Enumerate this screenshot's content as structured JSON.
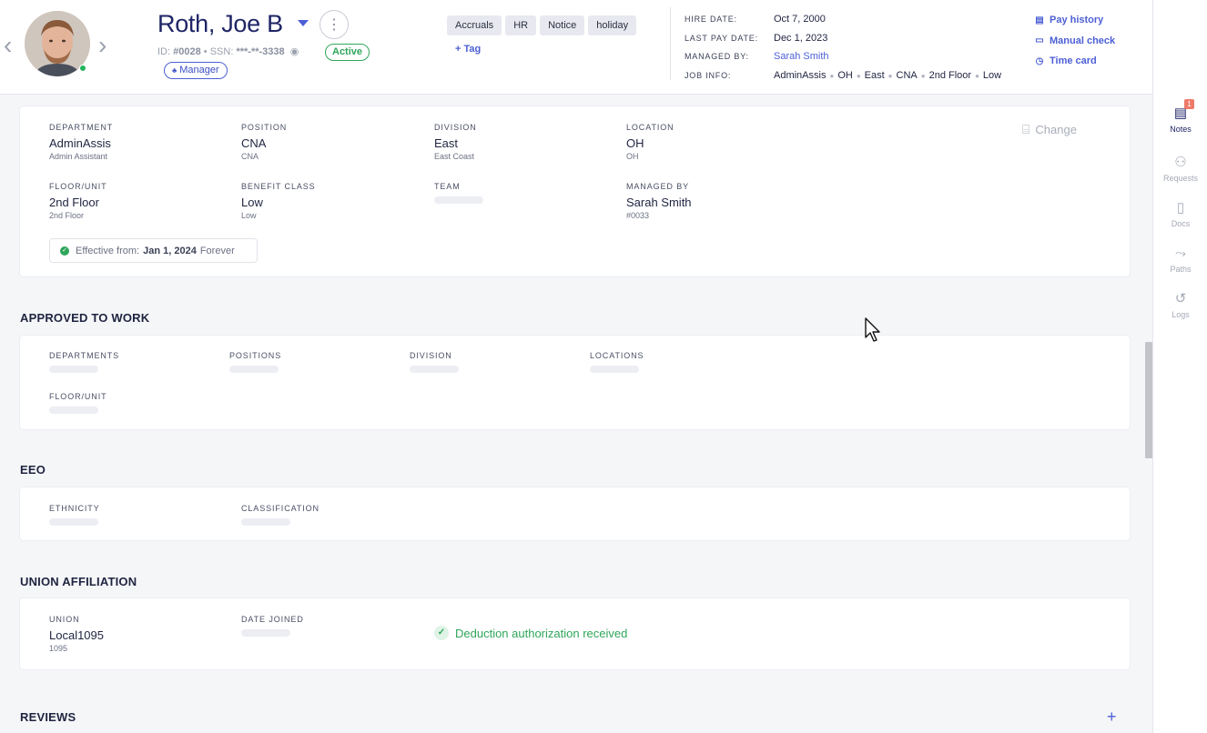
{
  "employee": {
    "name": "Roth, Joe B",
    "id_label": "ID:",
    "id": "#0028",
    "ssn_label": "SSN:",
    "ssn": "***-**-3338",
    "status": "Active",
    "role": "Manager",
    "status_color": "#2fa65a",
    "accent_color": "#4c5fd5"
  },
  "tags": [
    "Accruals",
    "HR",
    "Notice",
    "holiday"
  ],
  "add_tag_label": "+ Tag",
  "meta": {
    "hire_date_label": "HIRE DATE:",
    "hire_date": "Oct 7, 2000",
    "last_pay_label": "LAST PAY DATE:",
    "last_pay": "Dec 1, 2023",
    "managed_by_label": "MANAGED BY:",
    "managed_by": "Sarah Smith",
    "job_info_label": "JOB INFO:",
    "job_info": [
      "AdminAssis",
      "OH",
      "East",
      "CNA",
      "2nd Floor",
      "Low"
    ]
  },
  "quicklinks": {
    "pay_history": "Pay history",
    "manual_check": "Manual check",
    "time_card": "Time card"
  },
  "sidebar": {
    "notes": "Notes",
    "notes_count": "1",
    "requests": "Requests",
    "docs": "Docs",
    "paths": "Paths",
    "logs": "Logs"
  },
  "job": {
    "change_label": "Change",
    "department": {
      "label": "DEPARTMENT",
      "value": "AdminAssis",
      "sub": "Admin Assistant"
    },
    "position": {
      "label": "POSITION",
      "value": "CNA",
      "sub": "CNA"
    },
    "division": {
      "label": "DIVISION",
      "value": "East",
      "sub": "East Coast"
    },
    "location": {
      "label": "LOCATION",
      "value": "OH",
      "sub": "OH"
    },
    "floor": {
      "label": "FLOOR/UNIT",
      "value": "2nd Floor",
      "sub": "2nd Floor"
    },
    "benefit": {
      "label": "BENEFIT CLASS",
      "value": "Low",
      "sub": "Low"
    },
    "team": {
      "label": "TEAM"
    },
    "managed_by": {
      "label": "MANAGED BY",
      "value": "Sarah Smith",
      "sub": "#0033"
    },
    "effective_label": "Effective from:",
    "effective_date": "Jan 1, 2024",
    "effective_until": "Forever"
  },
  "approved": {
    "title": "APPROVED TO WORK",
    "departments": "DEPARTMENTS",
    "positions": "POSITIONS",
    "division": "DIVISION",
    "locations": "LOCATIONS",
    "floor": "FLOOR/UNIT"
  },
  "eeo": {
    "title": "EEO",
    "ethnicity": "ETHNICITY",
    "classification": "CLASSIFICATION"
  },
  "union": {
    "title": "UNION AFFILIATION",
    "union_label": "UNION",
    "union_value": "Local1095",
    "union_sub": "1095",
    "date_joined_label": "DATE JOINED",
    "deduction": "Deduction authorization received"
  },
  "reviews": {
    "title": "REVIEWS"
  }
}
